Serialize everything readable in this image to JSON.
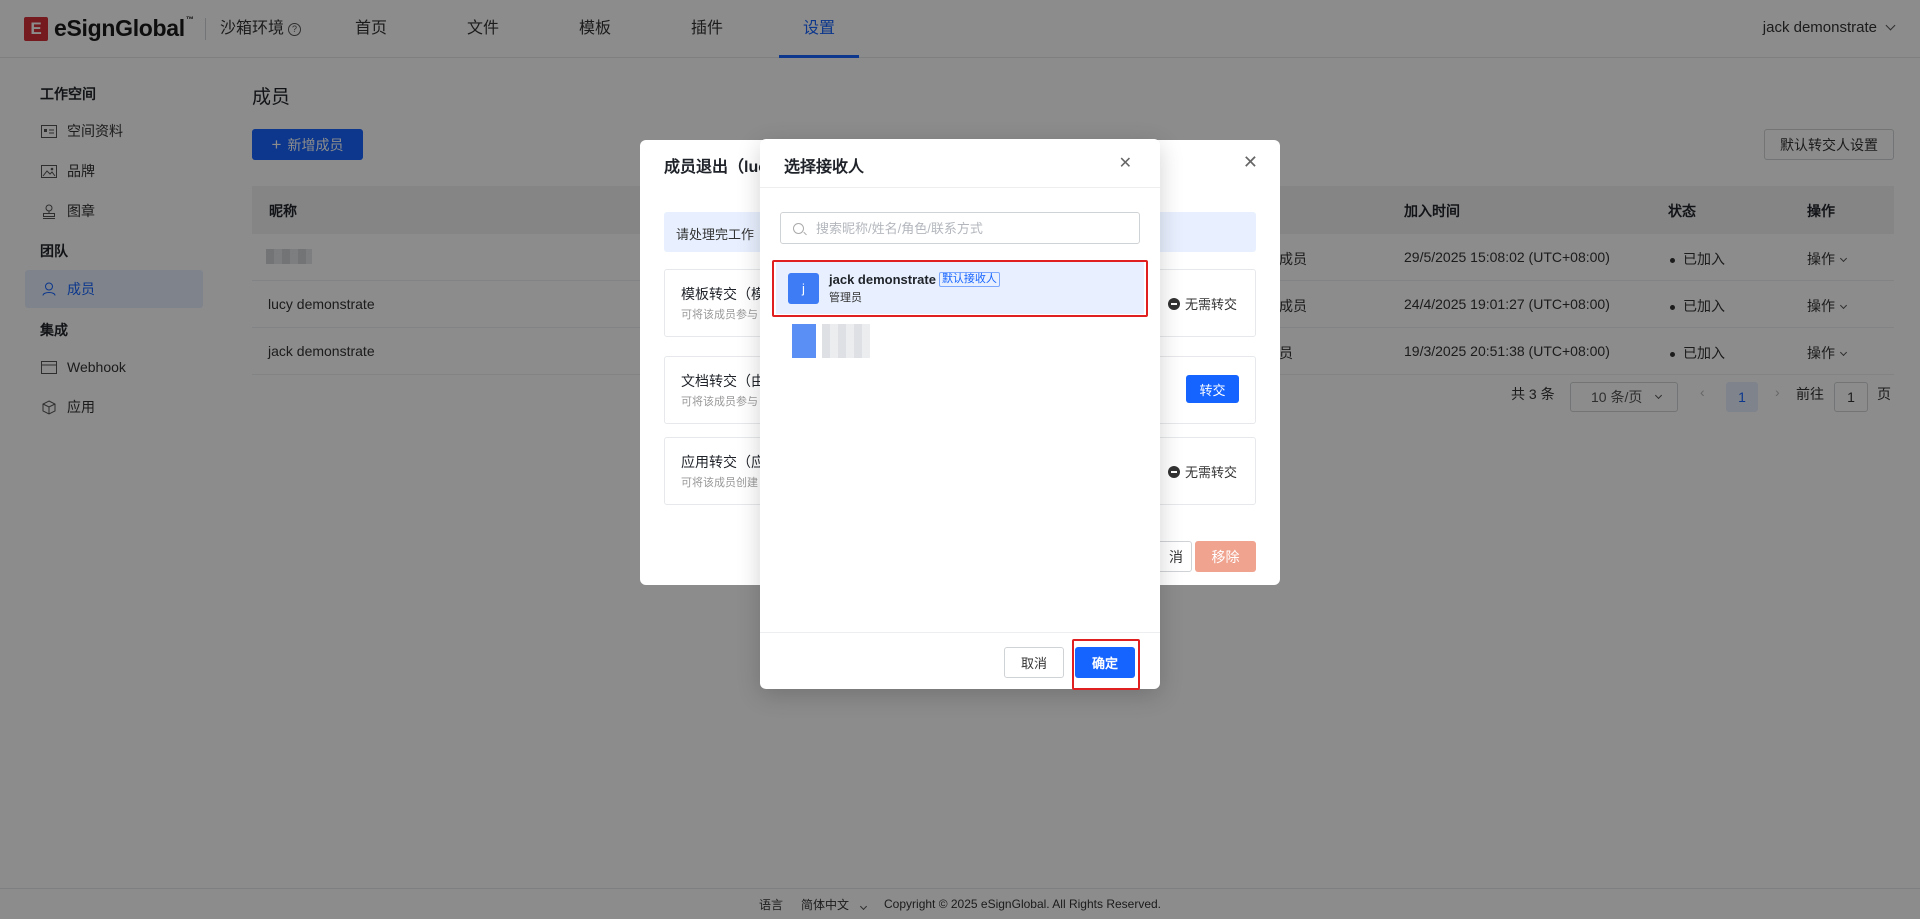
{
  "header": {
    "brand": "eSignGlobal",
    "brand_tm": "™",
    "sandbox_label": "沙箱环境",
    "nav": [
      "首页",
      "文件",
      "模板",
      "插件",
      "设置"
    ],
    "active_nav": "设置",
    "user": "jack demonstrate"
  },
  "sidebar": {
    "groups": [
      "工作空间",
      "团队",
      "集成"
    ],
    "items": [
      {
        "label": "空间资料",
        "icon": "profile-card-icon"
      },
      {
        "label": "品牌",
        "icon": "image-icon"
      },
      {
        "label": "图章",
        "icon": "stamp-icon"
      },
      {
        "label": "成员",
        "icon": "user-icon"
      },
      {
        "label": "Webhook",
        "icon": "webhook-icon"
      },
      {
        "label": "应用",
        "icon": "cube-icon"
      }
    ]
  },
  "main": {
    "title": "成员",
    "add_button": "新增成员",
    "default_transfer_button": "默认转交人设置",
    "columns": [
      "昵称",
      "加入时间",
      "状态",
      "操作"
    ],
    "rows": [
      {
        "nickname": "",
        "role_fragment": "成员",
        "joined": "29/5/2025 15:08:02 (UTC+08:00)",
        "status": "已加入",
        "action": "操作"
      },
      {
        "nickname": "lucy demonstrate",
        "role_fragment": "成员",
        "joined": "24/4/2025 19:01:27 (UTC+08:00)",
        "status": "已加入",
        "action": "操作"
      },
      {
        "nickname": "jack demonstrate",
        "role_fragment": "员",
        "joined": "19/3/2025 20:51:38 (UTC+08:00)",
        "status": "已加入",
        "action": "操作"
      }
    ],
    "pagination": {
      "total": "共 3 条",
      "page_size": "10 条/页",
      "current_page": "1",
      "goto_prefix": "前往",
      "goto_value": "1",
      "goto_suffix": "页"
    }
  },
  "leave_modal": {
    "title": "成员退出（luc",
    "alert": "请处理完工作",
    "cards": [
      {
        "title": "模板转交（模",
        "sub": "可将该成员参与",
        "status": "无需转交"
      },
      {
        "title": "文档转交（由",
        "sub": "可将该成员参与",
        "button": "转交"
      },
      {
        "title": "应用转交（应",
        "sub": "可将该成员创建",
        "status": "无需转交"
      }
    ],
    "cancel_fragment": "消",
    "remove_button": "移除"
  },
  "select_modal": {
    "title": "选择接收人",
    "search_placeholder": "搜索昵称/姓名/角色/联系方式",
    "recipients": [
      {
        "avatar": "j",
        "name": "jack demonstrate",
        "tag": "默认接收人",
        "role": "管理员",
        "selected": true
      }
    ],
    "cancel_button": "取消",
    "confirm_button": "确定"
  },
  "footer": {
    "language_label": "语言",
    "language_value": "简体中文",
    "copyright": "Copyright © 2025 eSignGlobal. All Rights Reserved."
  },
  "colors": {
    "primary": "#1664ff",
    "highlight": "#e02020",
    "brand_red": "#d6323a",
    "remove_button": "#f0a38f"
  }
}
